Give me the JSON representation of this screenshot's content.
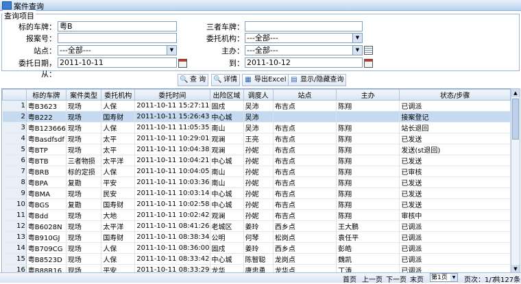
{
  "window": {
    "title": "案件查询"
  },
  "query": {
    "legend": "查询项目",
    "plate_label": "标的车牌：",
    "plate_value": "粤B",
    "third_plate_label": "三者车牌：",
    "third_plate_value": "",
    "report_label": "报案号：",
    "report_value": "",
    "agency_label": "委托机构：",
    "agency_value": "---全部---",
    "site_label": "站点：",
    "site_value": "---全部---",
    "handler_label": "主办：",
    "handler_value": "---全部---",
    "date_from_label": "委托日期，从：",
    "date_from_value": "2011-10-11",
    "date_to_label": "到：",
    "date_to_value": "2011-10-12"
  },
  "toolbar": {
    "query_label": "查 询",
    "detail_label": "详情",
    "export_label": "导出Excel",
    "toggle_label": "显示/隐藏查询"
  },
  "table": {
    "columns": [
      "",
      "标的车牌",
      "案件类型",
      "委托机构",
      "委托时间",
      "出险区域",
      "调度人",
      "站点",
      "主办",
      "状态/步骤"
    ],
    "rows": [
      [
        "1",
        "粤B3623",
        "现场",
        "人保",
        "2011-10-11 15:27:11",
        "固戍",
        "吴沛",
        "布吉点",
        "陈翔",
        "已调派"
      ],
      [
        "2",
        "粤B222",
        "现场",
        "国寿财",
        "2011-10-11 15:26:43",
        "中心城",
        "吴沛",
        "",
        "",
        "接案登记"
      ],
      [
        "3",
        "粤B123666",
        "现场",
        "人保",
        "2011-10-11 11:05:35",
        "南山",
        "吴沛",
        "布吉点",
        "陈翔",
        "站长退回"
      ],
      [
        "4",
        "粤Basdfsdf",
        "现场",
        "太平",
        "2011-10-11 10:29:01",
        "观澜",
        "王亮",
        "布吉点",
        "陈翔",
        "已发送"
      ],
      [
        "5",
        "粤BTP",
        "现场",
        "太平",
        "2011-10-11 10:04:38",
        "观澜",
        "孙妮",
        "布吉点",
        "陈翔",
        "发送(st退回)"
      ],
      [
        "6",
        "粤BTB",
        "三者物损",
        "太平洋",
        "2011-10-11 10:04:21",
        "中心城",
        "孙妮",
        "布吉点",
        "陈翔",
        "已发送"
      ],
      [
        "7",
        "粤BRB",
        "标的定损",
        "人保",
        "2011-10-11 10:04:05",
        "南山",
        "孙妮",
        "布吉点",
        "陈翔",
        "已审核"
      ],
      [
        "8",
        "粤BPA",
        "复勘",
        "平安",
        "2011-10-11 10:03:36",
        "南山",
        "孙妮",
        "布吉点",
        "陈翔",
        "已发送"
      ],
      [
        "9",
        "粤BMA",
        "现场",
        "民安",
        "2011-10-11 10:03:14",
        "中心城",
        "孙妮",
        "布吉点",
        "陈翔",
        "已发送"
      ],
      [
        "10",
        "粤BGS",
        "复勘",
        "国寿财",
        "2011-10-11 10:02:58",
        "中心城",
        "孙妮",
        "布吉点",
        "陈翔",
        "已发送"
      ],
      [
        "11",
        "粤Bdd",
        "现场",
        "大地",
        "2011-10-11 10:02:42",
        "观澜",
        "孙妮",
        "布吉点",
        "陈翔",
        "审核中"
      ],
      [
        "12",
        "粤B6028N",
        "现场",
        "太平洋",
        "2011-10-11 08:41:26",
        "老城区",
        "姜玲",
        "西乡点",
        "王大鹏",
        "已调派"
      ],
      [
        "13",
        "粤B910GJ",
        "现场",
        "国寿财",
        "2011-10-11 08:38:34",
        "公明",
        "何琴",
        "松岗点",
        "袁任平",
        "已调派"
      ],
      [
        "14",
        "粤B709CG",
        "现场",
        "人保",
        "2011-10-11 08:36:00",
        "固戍",
        "姜玲",
        "西乡点",
        "彭皓",
        "已调派"
      ],
      [
        "15",
        "粤B8523D",
        "现场",
        "人保",
        "2011-10-11 08:33:42",
        "中心城",
        "陈智聪",
        "龙岗点",
        "魏凯",
        "已调派"
      ],
      [
        "16",
        "粤B88R16",
        "现场",
        "平安",
        "2011-10-11 08:33:29",
        "龙华",
        "唐忠勇",
        "龙华点",
        "丁涛",
        "已调派"
      ],
      [
        "17",
        "粤B4030D",
        "现场",
        "太平洋",
        "2011-10-11 08:33:27",
        "观澜",
        "唐忠勇",
        "龙华点",
        "王海",
        "已调派"
      ]
    ],
    "selected_row": 1
  },
  "pager": {
    "first": "首页",
    "prev": "上一页",
    "next": "下一页",
    "last": "末页",
    "page_select": "第1页",
    "page_info": "页次：1/7",
    "total": "共127条"
  }
}
